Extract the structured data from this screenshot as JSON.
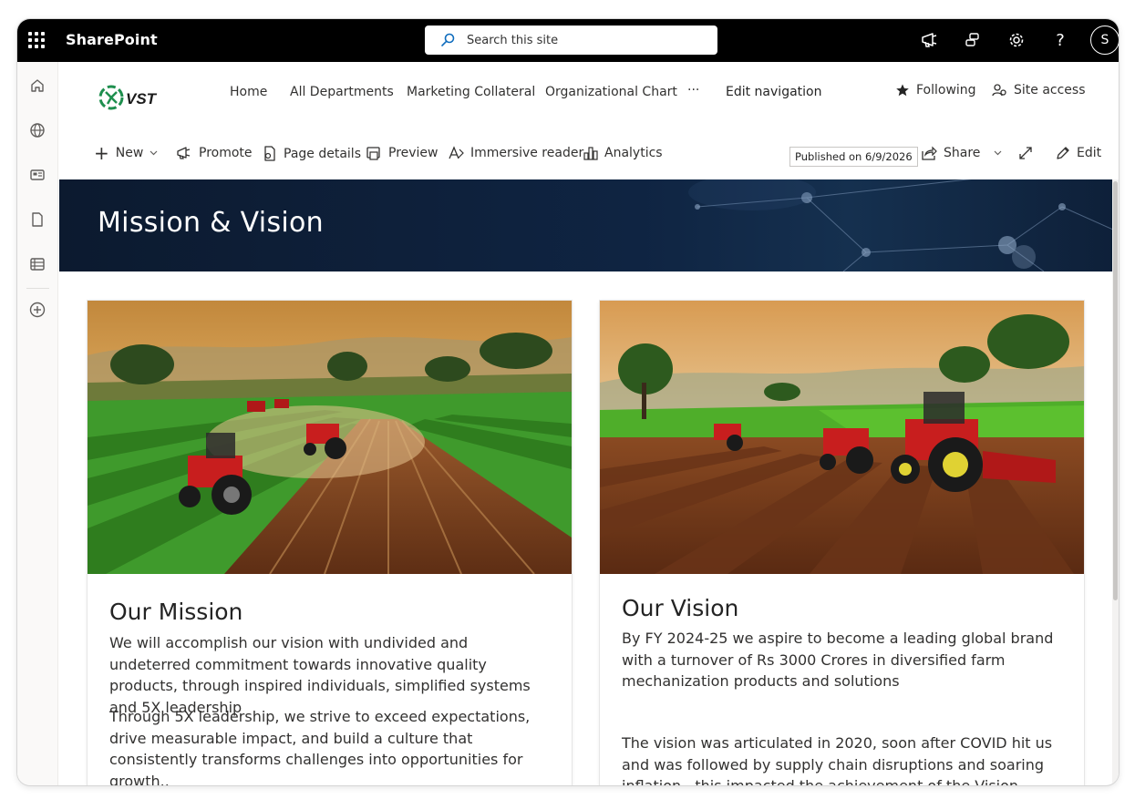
{
  "suite_bar": {
    "app_name": "SharePoint",
    "search_placeholder": "Search this site",
    "avatar_initial": "S",
    "icons": [
      "waffle-icon",
      "feedback-icon",
      "share-icon",
      "settings-icon",
      "help-icon"
    ]
  },
  "app_bar": {
    "icons": [
      "home-icon",
      "globe-icon",
      "news-icon",
      "file-icon",
      "list-icon",
      "add-icon"
    ]
  },
  "site_header": {
    "logo_text": "VST",
    "nav": [
      "Home",
      "All Departments",
      "Marketing Collateral",
      "Organizational Chart",
      "···",
      "Edit navigation"
    ],
    "following_label": "Following",
    "site_access_label": "Site access"
  },
  "command_bar": {
    "new_label": "New",
    "promote_label": "Promote",
    "page_details_label": "Page details",
    "preview_label": "Preview",
    "immersive_reader_label": "Immersive reader",
    "analytics_label": "Analytics",
    "published_label": "Published on 6/9/2026",
    "share_label": "Share",
    "edit_label": "Edit"
  },
  "page": {
    "title": "Mission & Vision"
  },
  "mission": {
    "heading": "Our Mission",
    "para1": "We will accomplish our vision with undivided and undeterred commitment towards innovative quality products, through inspired individuals, simplified systems and 5X leadership",
    "para2": "Through 5X leadership, we strive to exceed expectations, drive measurable impact, and build a culture that consistently transforms challenges into opportunities for growth.."
  },
  "vision": {
    "heading": "Our Vision",
    "para1": "By FY 2024-25 we aspire to become a leading global brand with a turnover of Rs 3000 Crores in diversified farm mechanization products and solutions",
    "para2": "The vision was articulated in 2020, soon after COVID hit us and was followed by supply chain disruptions and soaring inflation . this impacted the achievement of the Vision, however the company"
  },
  "colors": {
    "suite_bar": "#000000",
    "banner": "#0f2442",
    "logo_green": "#1e8f4e",
    "text": "#242424"
  }
}
